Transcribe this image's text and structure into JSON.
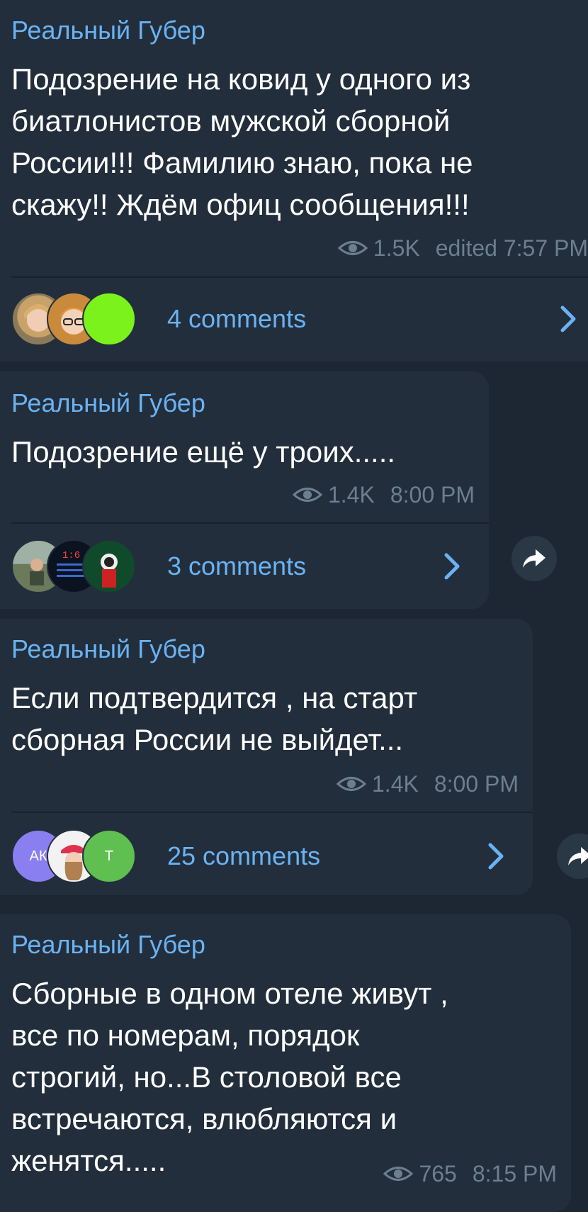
{
  "messages": [
    {
      "author": "Реальный Губер",
      "text": "Подозрение на ковид у одного из\nбиатлонистов мужской сборной\nРоссии!!! Фамилию знаю, пока не\nскажу!! Ждём офиц сообщения!!!",
      "views": "1.5K",
      "time": "edited 7:57 PM",
      "comments": "4 comments",
      "avatars": [
        "avatar-woman",
        "avatar-boy-glasses",
        "avatar-green"
      ]
    },
    {
      "author": "Реальный Губер",
      "text": "Подозрение ещё у троих.....",
      "views": "1.4K",
      "time": "8:00 PM",
      "comments": "3 comments",
      "avatars": [
        "avatar-outdoor",
        "avatar-scoreboard",
        "avatar-astronaut"
      ],
      "scoreboard_text": "1:6"
    },
    {
      "author": "Реальный Губер",
      "text": "Если подтвердится , на старт\nсборная России не выйдет...",
      "views": "1.4K",
      "time": "8:00 PM",
      "comments": "25 comments",
      "avatars": [
        "АК",
        "avatar-girl-cap",
        "Т"
      ]
    },
    {
      "author": "Реальный Губер",
      "text": "Сборные в одном отеле живут ,\nвсе по номерам, порядок\nстрогий, но...В столовой все\nвстречаются, влюбляются и\nженятся.....",
      "views": "765",
      "time": "8:15 PM"
    }
  ],
  "colors": {
    "background": "#1d2733",
    "bubble": "#232e3c",
    "accent": "#6ab3f3",
    "meta": "#6d7f8f"
  },
  "icons": [
    "eye-icon",
    "chevron-right-icon",
    "share-icon"
  ]
}
